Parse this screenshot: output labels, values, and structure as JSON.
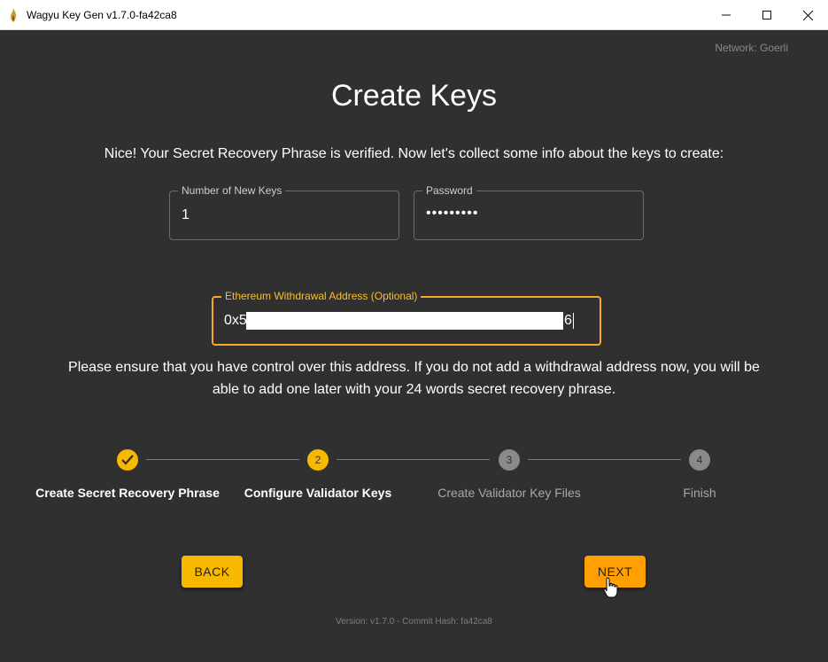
{
  "window": {
    "title": "Wagyu Key Gen v1.7.0-fa42ca8",
    "icon": "fire-icon"
  },
  "header": {
    "network": "Network: Goerli",
    "title": "Create Keys",
    "intro": "Nice! Your Secret Recovery Phrase is verified. Now let's collect some info about the keys to create:"
  },
  "form": {
    "num_keys_label": "Number of New Keys",
    "num_keys_value": "1",
    "password_label": "Password",
    "password_value": "•••••••••",
    "withdrawal_label": "Ethereum Withdrawal Address (Optional)",
    "withdrawal_prefix": "0x5",
    "withdrawal_suffix": "6",
    "note": "Please ensure that you have control over this address. If you do not add a withdrawal address now, you will be able to add one later with your 24 words secret recovery phrase."
  },
  "stepper": {
    "steps": [
      {
        "number": "✓",
        "label": "Create Secret Recovery Phrase",
        "state": "completed"
      },
      {
        "number": "2",
        "label": "Configure Validator Keys",
        "state": "active"
      },
      {
        "number": "3",
        "label": "Create Validator Key Files",
        "state": "pending"
      },
      {
        "number": "4",
        "label": "Finish",
        "state": "pending"
      }
    ]
  },
  "actions": {
    "back_label": "BACK",
    "next_label": "NEXT"
  },
  "footer": {
    "version": "Version: v1.7.0 - Commit Hash: fa42ca8"
  },
  "colors": {
    "background": "#303030",
    "accent": "#f9b800",
    "next_button": "#ffa000"
  }
}
